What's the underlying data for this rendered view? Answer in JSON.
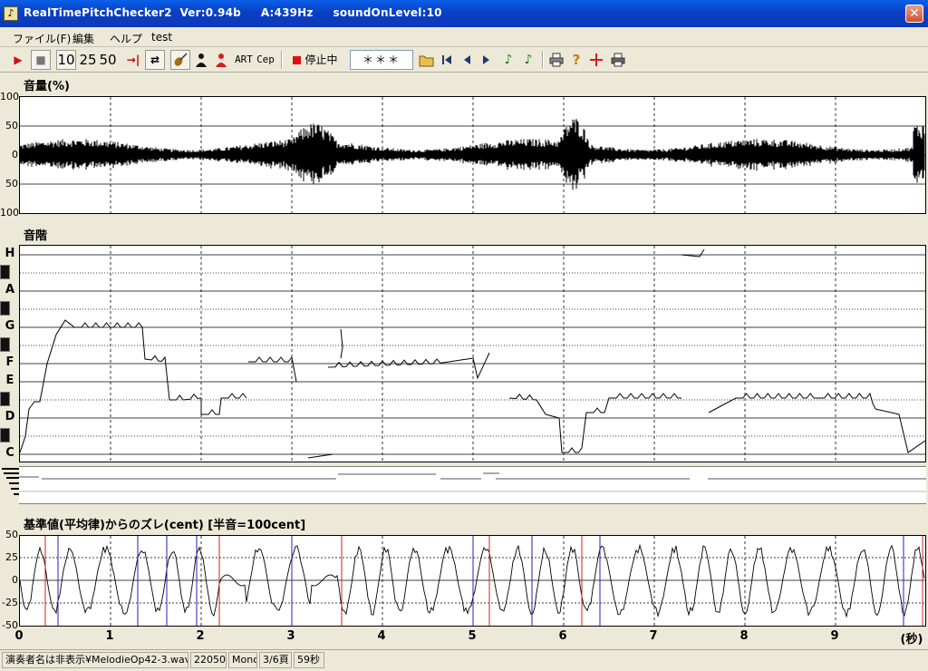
{
  "window": {
    "title": "RealTimePitchChecker2  Ver:0.94b     A:439Hz     soundOnLevel:10",
    "close_glyph": "✕"
  },
  "menu": [
    {
      "label": "ファイル(F)"
    },
    {
      "label": "編集"
    },
    {
      "label": "ヘルプ"
    },
    {
      "label": "test"
    }
  ],
  "toolbar": {
    "play": "▶",
    "stop": "■",
    "speed_10": "10",
    "speed_25": "25",
    "speed_50": "50",
    "jump_end": "→|",
    "loop": "⇄",
    "art": "ART",
    "cep": "Cep",
    "record_label": "停止中",
    "note_display": "＊＊＊",
    "icons": [
      "play-icon",
      "stop-icon",
      "jump-end-icon",
      "loop-icon",
      "violin-icon",
      "person-black-icon",
      "person-red-icon",
      "record-icon",
      "folder-open-icon",
      "skip-start-icon",
      "step-back-icon",
      "step-forward-icon",
      "note-green-icon",
      "note-green2-icon",
      "print-icon",
      "help-icon",
      "marker-icon",
      "printer-icon"
    ]
  },
  "volume_panel": {
    "title": "音量(%)",
    "y_labels": [
      "100",
      "50",
      "0",
      "50",
      "100"
    ]
  },
  "scale_panel": {
    "title": "音階",
    "notes": [
      "H",
      "A",
      "G",
      "F",
      "E",
      "D",
      "C"
    ]
  },
  "cent_panel": {
    "title": "基準値(平均律)からのズレ(cent) [半音=100cent]",
    "y_labels": [
      "50",
      "25",
      "0",
      "-25",
      "-50"
    ]
  },
  "x_axis": {
    "ticks": [
      "0",
      "1",
      "2",
      "3",
      "4",
      "5",
      "6",
      "7",
      "8",
      "9"
    ],
    "unit": "(秒)"
  },
  "statusbar": {
    "file": "演奏者名は非表示¥MelodieOp42-3.wav",
    "rate": "22050",
    "channels": "Mono",
    "page": "3/6頁",
    "duration": "59秒"
  }
}
